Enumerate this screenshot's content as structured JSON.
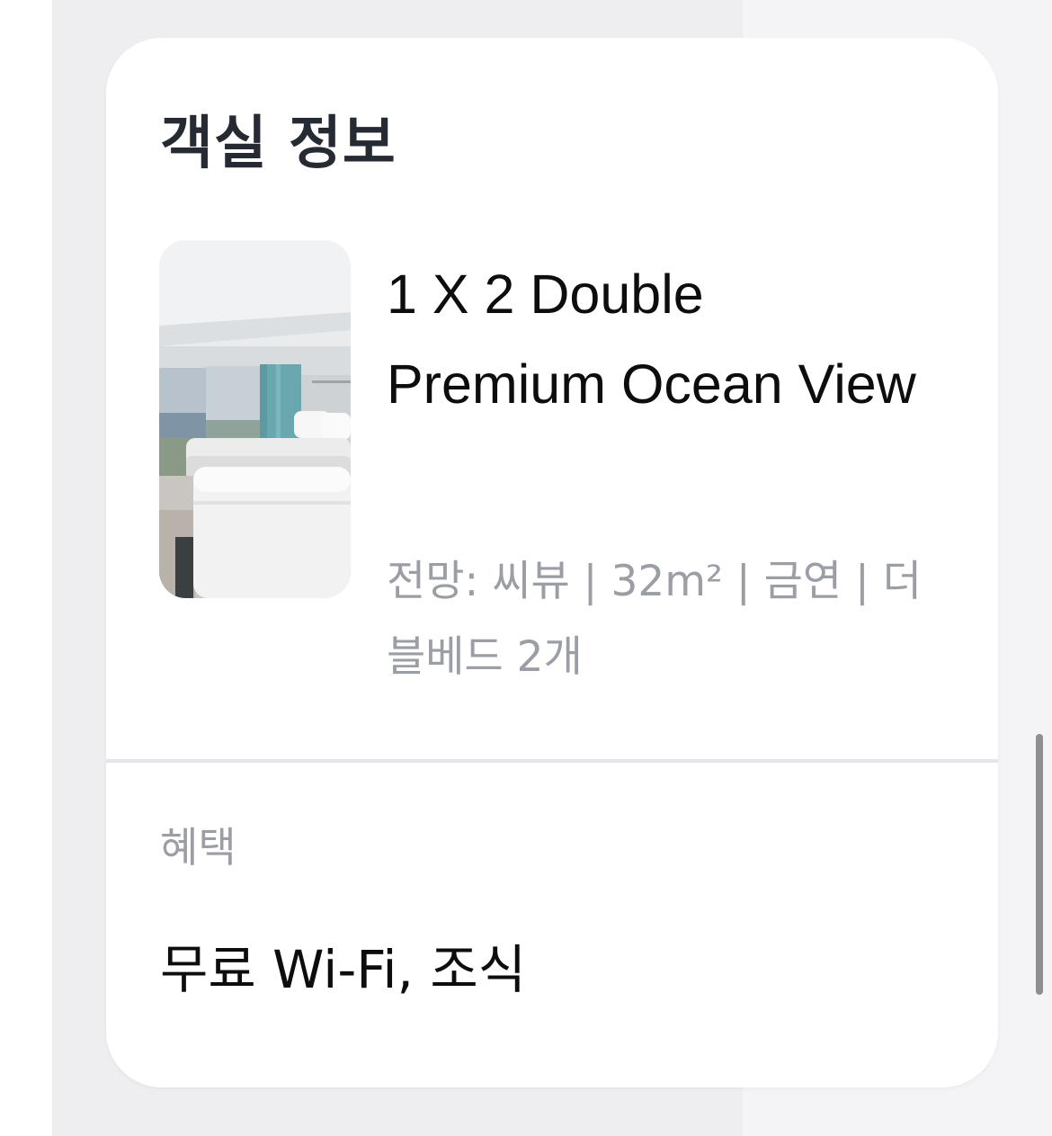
{
  "room_section": {
    "title": "객실 정보",
    "room_name": "1 X 2 Double Premium Ocean View",
    "details": "전망: 씨뷰 | 32m² | 금연 | 더블베드 2개",
    "photo_icon": "room-photo"
  },
  "benefits": {
    "label": "혜택",
    "value": "무료 Wi-Fi, 조식"
  },
  "colors": {
    "title_text": "#262a33",
    "secondary_text": "#9b9ea5",
    "primary_text": "#0d0d0d",
    "divider": "#e5e5ea",
    "card_background": "#ffffff",
    "page_background": "#eeeef1"
  }
}
